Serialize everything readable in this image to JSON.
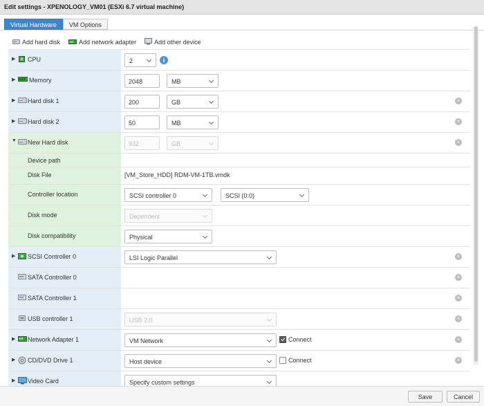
{
  "window": {
    "title": "Edit settings - XPENOLOGY_VM01 (ESXi 6.7 virtual machine)"
  },
  "tabs": [
    {
      "label": "Virtual Hardware"
    },
    {
      "label": "VM Options"
    }
  ],
  "toolbar": {
    "add_hard_disk": "Add hard disk",
    "add_network_adapter": "Add network adapter",
    "add_other_device": "Add other device"
  },
  "hardware": {
    "cpu": {
      "label": "CPU",
      "value": "2"
    },
    "memory": {
      "label": "Memory",
      "value": "2048",
      "unit": "MB"
    },
    "hard_disk_1": {
      "label": "Hard disk 1",
      "value": "200",
      "unit": "GB"
    },
    "hard_disk_2": {
      "label": "Hard disk 2",
      "value": "50",
      "unit": "MB"
    },
    "new_hard_disk": {
      "label": "New Hard disk",
      "value": "932",
      "unit": "GB",
      "device_path_label": "Device path",
      "disk_file_label": "Disk File",
      "disk_file": "[VM_Store_HDD] RDM-VM-1TB.vmdk",
      "controller_location_label": "Controller location",
      "controller": "SCSI controller 0",
      "controller_slot": "SCSI (0:0)",
      "disk_mode_label": "Disk mode",
      "disk_mode": "Dependent",
      "disk_compatibility_label": "Disk compatibility",
      "disk_compatibility": "Physical"
    },
    "scsi_controller_0": {
      "label": "SCSI Controller 0",
      "value": "LSI Logic Parallel"
    },
    "sata_controller_0": {
      "label": "SATA Controller 0"
    },
    "sata_controller_1": {
      "label": "SATA Controller 1"
    },
    "usb_controller_1": {
      "label": "USB controller 1",
      "value": "USB 2.0"
    },
    "network_adapter_1": {
      "label": "Network Adapter 1",
      "value": "VM Network",
      "connect_label": "Connect",
      "connected": true
    },
    "cd_dvd_drive_1": {
      "label": "CD/DVD Drive 1",
      "value": "Host device",
      "connect_label": "Connect",
      "connected": false
    },
    "video_card": {
      "label": "Video Card",
      "value": "Specify custom settings"
    }
  },
  "icons": {
    "remove": "remove-icon",
    "info": "info-icon",
    "info_glyph": "i",
    "remove_glyph": "×"
  },
  "footer": {
    "save_label": "Save",
    "cancel_label": "Cancel"
  },
  "colors": {
    "accent": "#3f86c9",
    "label_bg": "#e3eef7",
    "highlight_bg": "#dff2dd"
  }
}
